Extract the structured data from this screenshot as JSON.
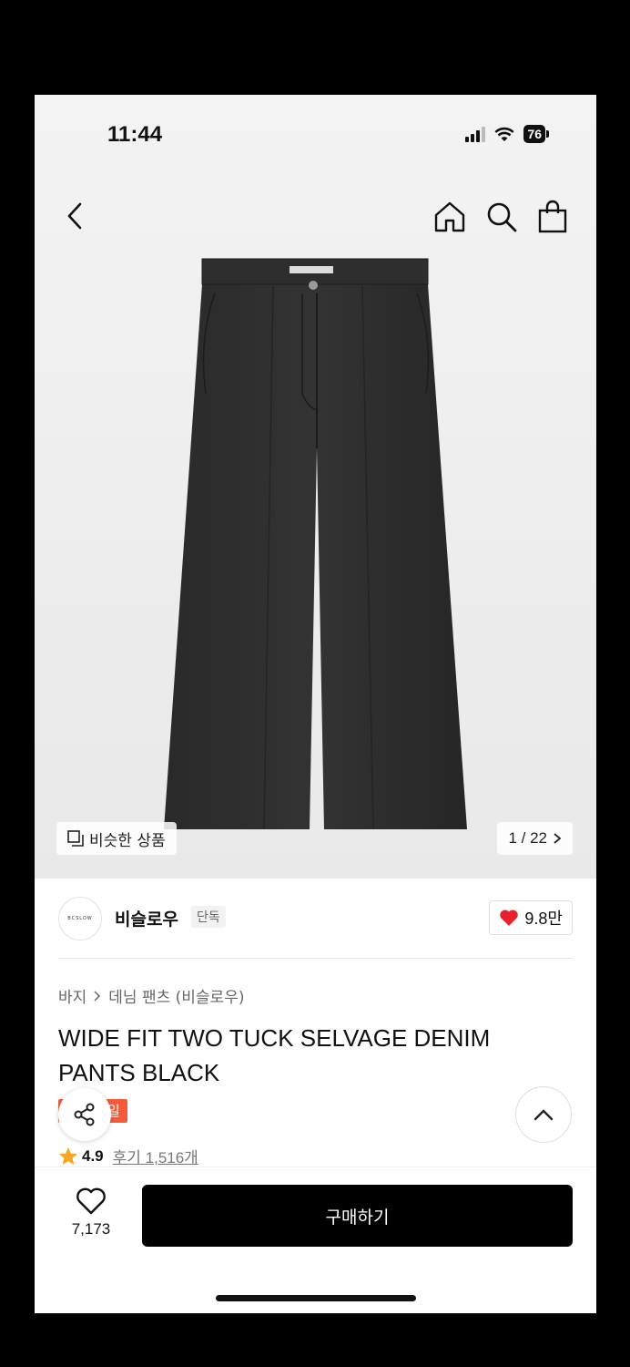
{
  "status": {
    "time": "11:44",
    "battery": "76"
  },
  "hero": {
    "similar_label": "비슷한 상품",
    "counter": "1 / 22"
  },
  "brand": {
    "logo_text": "BCSLOW",
    "name": "비슬로우",
    "tag": "단독",
    "likes": "9.8만"
  },
  "breadcrumb": {
    "level1": "바지",
    "level2": "데님 팬츠 (비슬로우)"
  },
  "product": {
    "title": "WIDE FIT TWO TUCK SELVAGE DENIM PANTS BLACK",
    "badge": "일",
    "rating": "4.9",
    "reviews": "후기 1,516개"
  },
  "bottom": {
    "wish_count": "7,173",
    "buy_label": "구매하기"
  },
  "colors": {
    "accent": "#f25c3b",
    "heart": "#e8212e",
    "star": "#f5a623"
  },
  "icons": [
    "back-arrow-icon",
    "home-icon",
    "search-icon",
    "shopping-bag-icon",
    "similar-icon",
    "chevron-right-icon",
    "heart-icon",
    "share-icon",
    "chevron-up-icon",
    "star-icon",
    "heart-outline-icon"
  ]
}
